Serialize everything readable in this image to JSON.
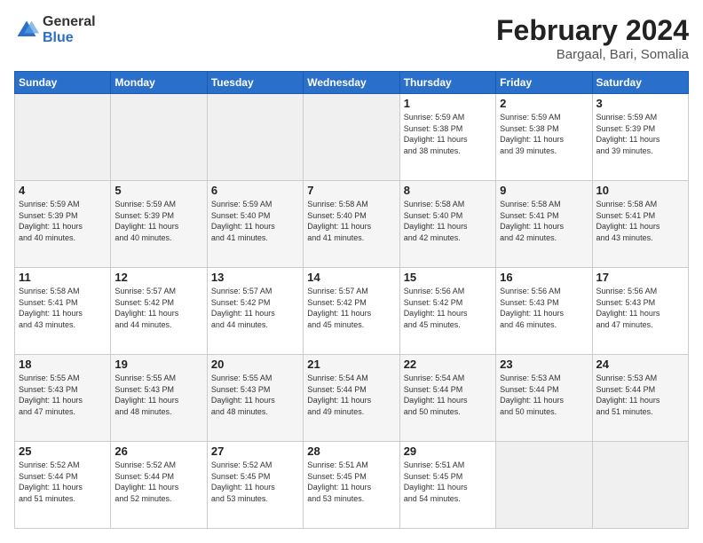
{
  "logo": {
    "general": "General",
    "blue": "Blue"
  },
  "title": "February 2024",
  "subtitle": "Bargaal, Bari, Somalia",
  "headers": [
    "Sunday",
    "Monday",
    "Tuesday",
    "Wednesday",
    "Thursday",
    "Friday",
    "Saturday"
  ],
  "weeks": [
    [
      {
        "day": "",
        "info": ""
      },
      {
        "day": "",
        "info": ""
      },
      {
        "day": "",
        "info": ""
      },
      {
        "day": "",
        "info": ""
      },
      {
        "day": "1",
        "info": "Sunrise: 5:59 AM\nSunset: 5:38 PM\nDaylight: 11 hours\nand 38 minutes."
      },
      {
        "day": "2",
        "info": "Sunrise: 5:59 AM\nSunset: 5:38 PM\nDaylight: 11 hours\nand 39 minutes."
      },
      {
        "day": "3",
        "info": "Sunrise: 5:59 AM\nSunset: 5:39 PM\nDaylight: 11 hours\nand 39 minutes."
      }
    ],
    [
      {
        "day": "4",
        "info": "Sunrise: 5:59 AM\nSunset: 5:39 PM\nDaylight: 11 hours\nand 40 minutes."
      },
      {
        "day": "5",
        "info": "Sunrise: 5:59 AM\nSunset: 5:39 PM\nDaylight: 11 hours\nand 40 minutes."
      },
      {
        "day": "6",
        "info": "Sunrise: 5:59 AM\nSunset: 5:40 PM\nDaylight: 11 hours\nand 41 minutes."
      },
      {
        "day": "7",
        "info": "Sunrise: 5:58 AM\nSunset: 5:40 PM\nDaylight: 11 hours\nand 41 minutes."
      },
      {
        "day": "8",
        "info": "Sunrise: 5:58 AM\nSunset: 5:40 PM\nDaylight: 11 hours\nand 42 minutes."
      },
      {
        "day": "9",
        "info": "Sunrise: 5:58 AM\nSunset: 5:41 PM\nDaylight: 11 hours\nand 42 minutes."
      },
      {
        "day": "10",
        "info": "Sunrise: 5:58 AM\nSunset: 5:41 PM\nDaylight: 11 hours\nand 43 minutes."
      }
    ],
    [
      {
        "day": "11",
        "info": "Sunrise: 5:58 AM\nSunset: 5:41 PM\nDaylight: 11 hours\nand 43 minutes."
      },
      {
        "day": "12",
        "info": "Sunrise: 5:57 AM\nSunset: 5:42 PM\nDaylight: 11 hours\nand 44 minutes."
      },
      {
        "day": "13",
        "info": "Sunrise: 5:57 AM\nSunset: 5:42 PM\nDaylight: 11 hours\nand 44 minutes."
      },
      {
        "day": "14",
        "info": "Sunrise: 5:57 AM\nSunset: 5:42 PM\nDaylight: 11 hours\nand 45 minutes."
      },
      {
        "day": "15",
        "info": "Sunrise: 5:56 AM\nSunset: 5:42 PM\nDaylight: 11 hours\nand 45 minutes."
      },
      {
        "day": "16",
        "info": "Sunrise: 5:56 AM\nSunset: 5:43 PM\nDaylight: 11 hours\nand 46 minutes."
      },
      {
        "day": "17",
        "info": "Sunrise: 5:56 AM\nSunset: 5:43 PM\nDaylight: 11 hours\nand 47 minutes."
      }
    ],
    [
      {
        "day": "18",
        "info": "Sunrise: 5:55 AM\nSunset: 5:43 PM\nDaylight: 11 hours\nand 47 minutes."
      },
      {
        "day": "19",
        "info": "Sunrise: 5:55 AM\nSunset: 5:43 PM\nDaylight: 11 hours\nand 48 minutes."
      },
      {
        "day": "20",
        "info": "Sunrise: 5:55 AM\nSunset: 5:43 PM\nDaylight: 11 hours\nand 48 minutes."
      },
      {
        "day": "21",
        "info": "Sunrise: 5:54 AM\nSunset: 5:44 PM\nDaylight: 11 hours\nand 49 minutes."
      },
      {
        "day": "22",
        "info": "Sunrise: 5:54 AM\nSunset: 5:44 PM\nDaylight: 11 hours\nand 50 minutes."
      },
      {
        "day": "23",
        "info": "Sunrise: 5:53 AM\nSunset: 5:44 PM\nDaylight: 11 hours\nand 50 minutes."
      },
      {
        "day": "24",
        "info": "Sunrise: 5:53 AM\nSunset: 5:44 PM\nDaylight: 11 hours\nand 51 minutes."
      }
    ],
    [
      {
        "day": "25",
        "info": "Sunrise: 5:52 AM\nSunset: 5:44 PM\nDaylight: 11 hours\nand 51 minutes."
      },
      {
        "day": "26",
        "info": "Sunrise: 5:52 AM\nSunset: 5:44 PM\nDaylight: 11 hours\nand 52 minutes."
      },
      {
        "day": "27",
        "info": "Sunrise: 5:52 AM\nSunset: 5:45 PM\nDaylight: 11 hours\nand 53 minutes."
      },
      {
        "day": "28",
        "info": "Sunrise: 5:51 AM\nSunset: 5:45 PM\nDaylight: 11 hours\nand 53 minutes."
      },
      {
        "day": "29",
        "info": "Sunrise: 5:51 AM\nSunset: 5:45 PM\nDaylight: 11 hours\nand 54 minutes."
      },
      {
        "day": "",
        "info": ""
      },
      {
        "day": "",
        "info": ""
      }
    ]
  ]
}
